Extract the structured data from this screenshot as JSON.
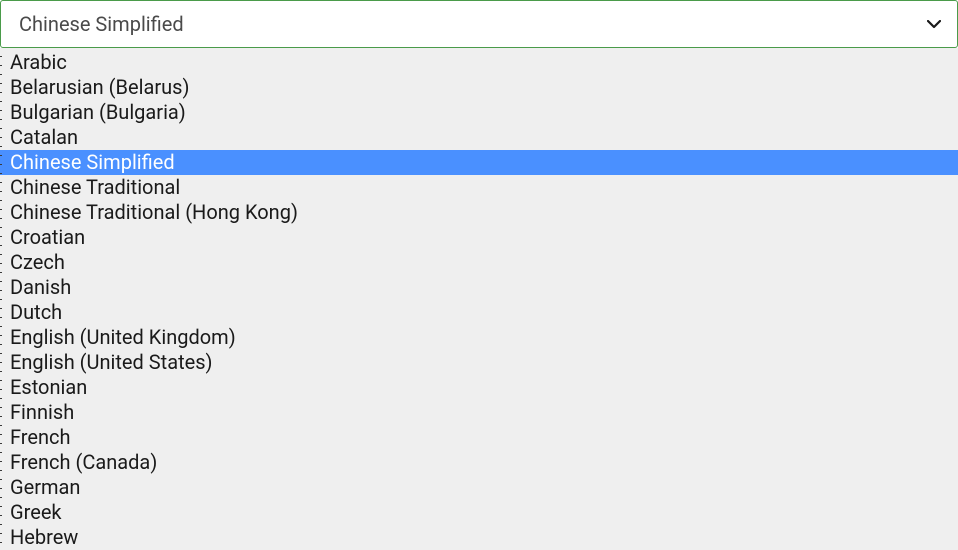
{
  "select": {
    "value": "Chinese Simplified",
    "options": [
      {
        "label": "Arabic",
        "selected": false
      },
      {
        "label": "Belarusian (Belarus)",
        "selected": false
      },
      {
        "label": "Bulgarian (Bulgaria)",
        "selected": false
      },
      {
        "label": "Catalan",
        "selected": false
      },
      {
        "label": "Chinese Simplified",
        "selected": true
      },
      {
        "label": "Chinese Traditional",
        "selected": false
      },
      {
        "label": "Chinese Traditional (Hong Kong)",
        "selected": false
      },
      {
        "label": "Croatian",
        "selected": false
      },
      {
        "label": "Czech",
        "selected": false
      },
      {
        "label": "Danish",
        "selected": false
      },
      {
        "label": "Dutch",
        "selected": false
      },
      {
        "label": "English (United Kingdom)",
        "selected": false
      },
      {
        "label": "English (United States)",
        "selected": false
      },
      {
        "label": "Estonian",
        "selected": false
      },
      {
        "label": "Finnish",
        "selected": false
      },
      {
        "label": "French",
        "selected": false
      },
      {
        "label": "French (Canada)",
        "selected": false
      },
      {
        "label": "German",
        "selected": false
      },
      {
        "label": "Greek",
        "selected": false
      },
      {
        "label": "Hebrew",
        "selected": false
      }
    ]
  }
}
